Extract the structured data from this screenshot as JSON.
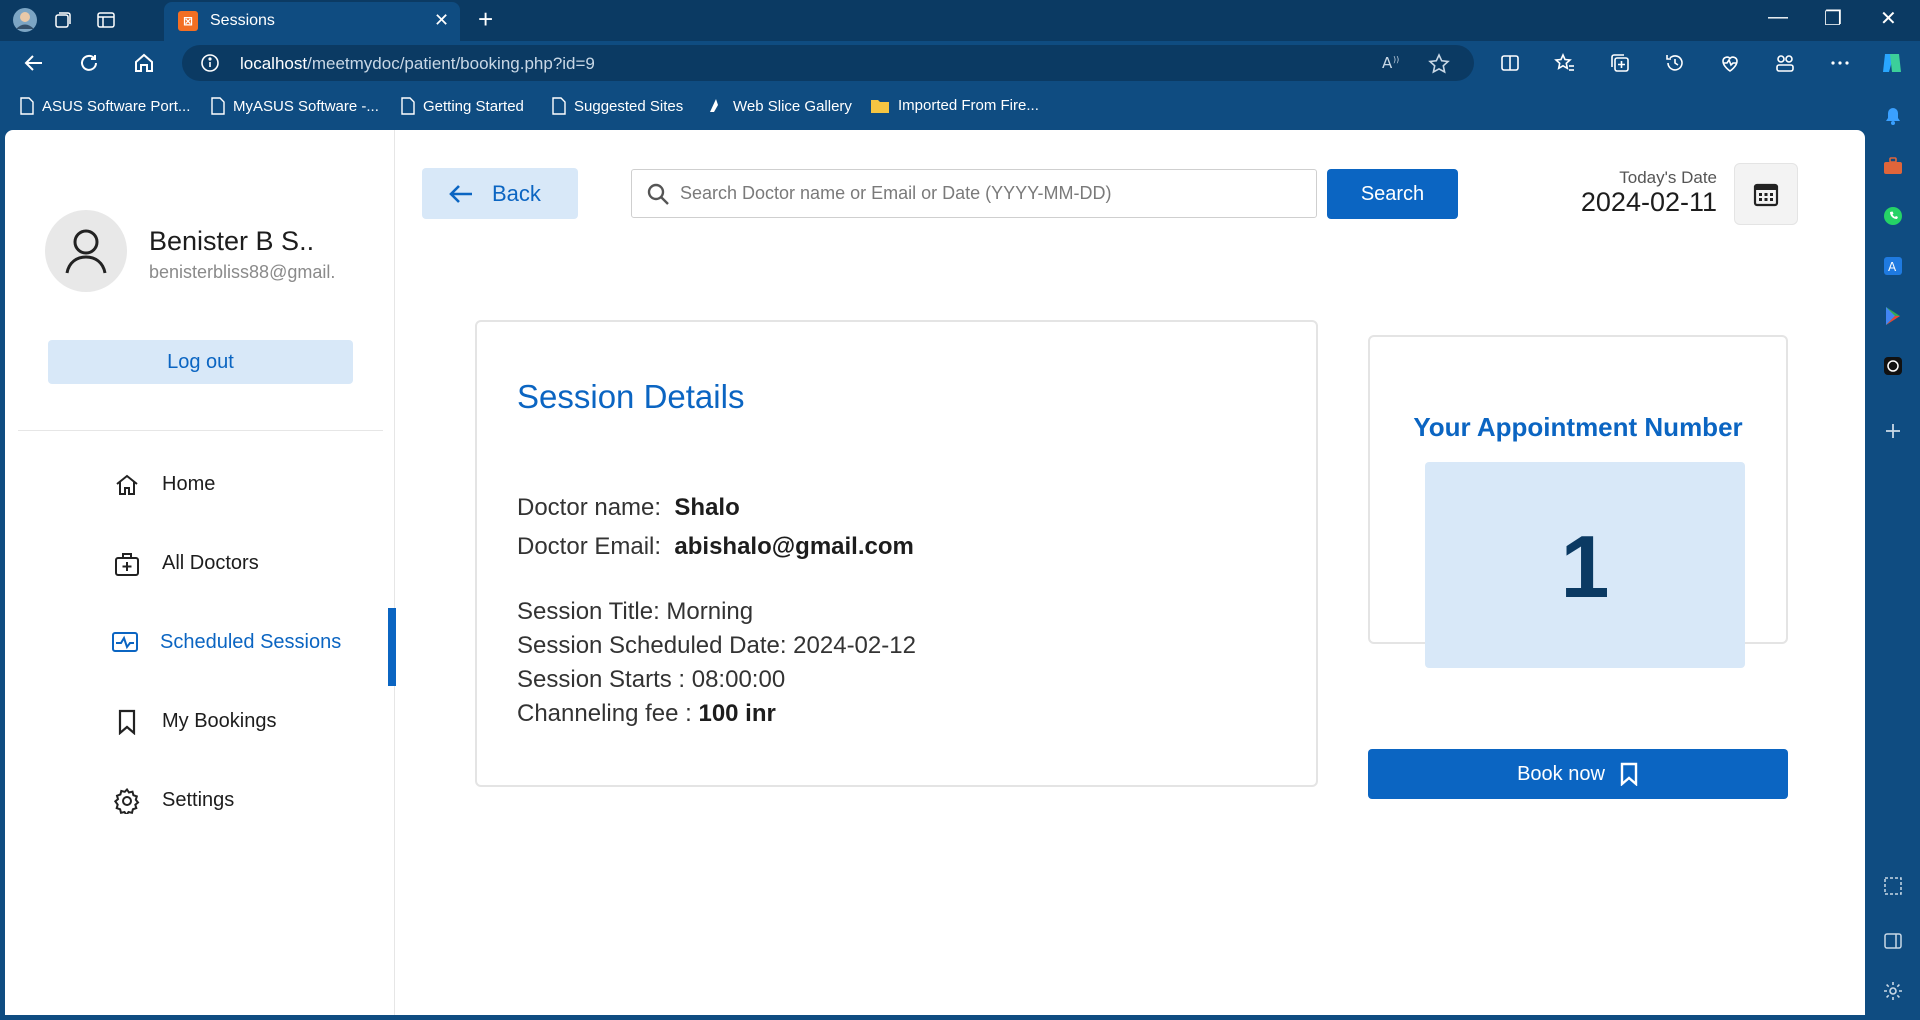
{
  "browser": {
    "tab_title": "Sessions",
    "address_host": "localhost",
    "address_path": "/meetmydoc/patient/booking.php?id=9",
    "favorites": [
      "ASUS Software Port...",
      "MyASUS Software -...",
      "Getting Started",
      "Suggested Sites",
      "Web Slice Gallery",
      "Imported From Fire..."
    ]
  },
  "profile": {
    "name": "Benister B S..",
    "email": "benisterbliss88@gmail.",
    "logout_label": "Log out"
  },
  "menu": {
    "items": [
      "Home",
      "All Doctors",
      "Scheduled Sessions",
      "My Bookings",
      "Settings"
    ],
    "active": "Scheduled Sessions"
  },
  "toolbar": {
    "back_label": "Back",
    "search_placeholder": "Search Doctor name or Email or Date (YYYY-MM-DD)",
    "search_label": "Search",
    "date_label": "Today's Date",
    "date_value": "2024-02-11"
  },
  "session": {
    "heading": "Session Details",
    "doctor_name_label": "Doctor name:",
    "doctor_name": "Shalo",
    "doctor_email_label": "Doctor Email:",
    "doctor_email": "abishalo@gmail.com",
    "title_line": "Session Title: Morning",
    "date_line": "Session Scheduled Date: 2024-02-12",
    "starts_line": "Session Starts : 08:00:00",
    "fee_label": "Channeling fee :",
    "fee_value": "100 inr"
  },
  "appointment": {
    "heading": "Your Appointment Number",
    "number": "1",
    "book_label": "Book now"
  },
  "colors": {
    "accent": "#0b65c2",
    "accent_light": "#d8e8f8",
    "chrome": "#0f4c81"
  }
}
